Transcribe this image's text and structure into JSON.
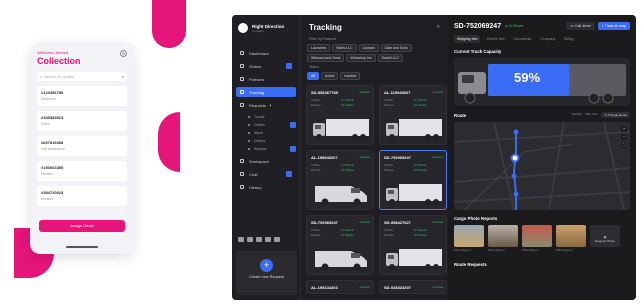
{
  "phone": {
    "welcome": "Welcome, Ahmed",
    "title": "Collection",
    "search_placeholder": "Search for orders",
    "orders": [
      {
        "id": "#123456789",
        "status": "Delivered"
      },
      {
        "id": "#345383513",
        "status": "Sales"
      },
      {
        "id": "#837816068",
        "status": "Left warehouse"
      },
      {
        "id": "#193063455",
        "status": "Retailer"
      },
      {
        "id": "#384720023",
        "status": "Retailer"
      }
    ],
    "assign_label": "Assign Driver"
  },
  "sidebar": {
    "brand_name": "Right Direction",
    "brand_sub": "Logistics",
    "items": [
      {
        "label": "Dashboard"
      },
      {
        "label": "Orders"
      },
      {
        "label": "Partners"
      },
      {
        "label": "Tracking"
      },
      {
        "label": "Requests"
      },
      {
        "label": "Trucks"
      },
      {
        "label": "Orders"
      },
      {
        "label": "Stock"
      },
      {
        "label": "Drivers"
      },
      {
        "label": "Reports"
      },
      {
        "label": "Workspace"
      },
      {
        "label": "Chat"
      },
      {
        "label": "History"
      }
    ],
    "create_label": "Create new Request"
  },
  "tracking": {
    "title": "Tracking",
    "filter_label": "Filter by Features",
    "feature_chips": [
      "Launches",
      "Warts LLC",
      "Contact",
      "Gale and Sons",
      "Welsand and Sons",
      "Workshop Inc",
      "Daniel LLC"
    ],
    "status_label": "Status",
    "status_chips": [
      "All",
      "Active",
      "Inactive"
    ],
    "cards": [
      {
        "id": "SD-956367765",
        "status": "Active"
      },
      {
        "id": "AL-119945207",
        "status": "Active"
      },
      {
        "id": "AL-198943207",
        "status": "Active"
      },
      {
        "id": "SD-752069247",
        "status": "Active"
      },
      {
        "id": "SD-752069247",
        "status": "Active"
      },
      {
        "id": "SD-958427627",
        "status": "Active"
      },
      {
        "id": "AL-198134203",
        "status": "Active"
      },
      {
        "id": "SD-928323207",
        "status": "Active"
      }
    ],
    "card_meta_left": [
      "Trucks",
      "Drivers"
    ],
    "card_meta_right": [
      "In Transit",
      "On Route"
    ]
  },
  "detail": {
    "title": "SD-752069247",
    "status": "On Route",
    "btn_call": "Call driver",
    "btn_track": "Track on map",
    "tabs": [
      "Shipping Info",
      "Vehicle Info",
      "Documents",
      "Company",
      "Billing"
    ],
    "capacity_title": "Current Truck Capacity",
    "capacity_pct": "59%",
    "capacity_value": 0.59,
    "route_title": "Route",
    "route_tools": [
      "Satellite",
      "Map View"
    ],
    "route_btn": "Change Route",
    "map_controls": [
      "+",
      "−",
      "⛶"
    ],
    "photos_title": "Cargo Photo Reports",
    "photos": [
      {
        "caption": "Photo Report"
      },
      {
        "caption": "Photo Report"
      },
      {
        "caption": "Photo Report"
      },
      {
        "caption": "Photo Report"
      }
    ],
    "add_photo": "Request Photo",
    "route_requests_title": "Route Requests"
  },
  "colors": {
    "accent": "#e5157a",
    "primary": "#3b6cf5",
    "success": "#31c56a"
  }
}
